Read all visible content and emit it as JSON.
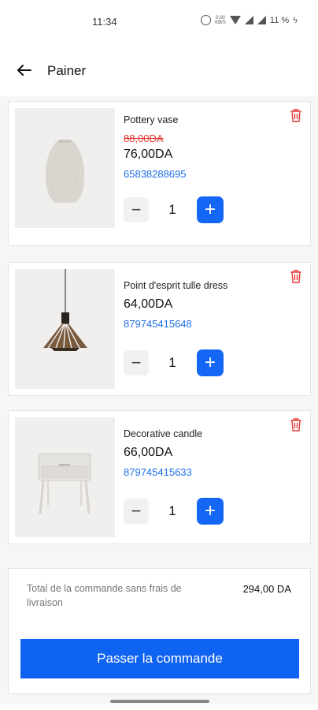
{
  "status_bar": {
    "time": "11:34",
    "speed": "0.00\nKB/S",
    "battery": "11 %"
  },
  "header": {
    "back_icon": "arrow-left-icon",
    "title": "Painer"
  },
  "cart": {
    "items": [
      {
        "name": "Pottery vase",
        "old_price": "88,00DA",
        "price": "76,00DA",
        "sku": "65838288695",
        "quantity": "1",
        "image": "vase"
      },
      {
        "name": "Point d'esprit tulle dress",
        "old_price": "",
        "price": "64,00DA",
        "sku": "879745415648",
        "quantity": "1",
        "image": "pendant-lamp"
      },
      {
        "name": "Decorative candle",
        "old_price": "",
        "price": "66,00DA",
        "sku": "879745415633",
        "quantity": "1",
        "image": "side-table"
      }
    ]
  },
  "summary": {
    "total_label": "Total de la commande sans frais de livraison",
    "total_value": "294,00 DA",
    "order_button": "Passer la commande"
  },
  "colors": {
    "accent": "#1466f5",
    "strike_price": "#e53935",
    "sku_link": "#1e6ee8",
    "trash": "#e53935"
  }
}
